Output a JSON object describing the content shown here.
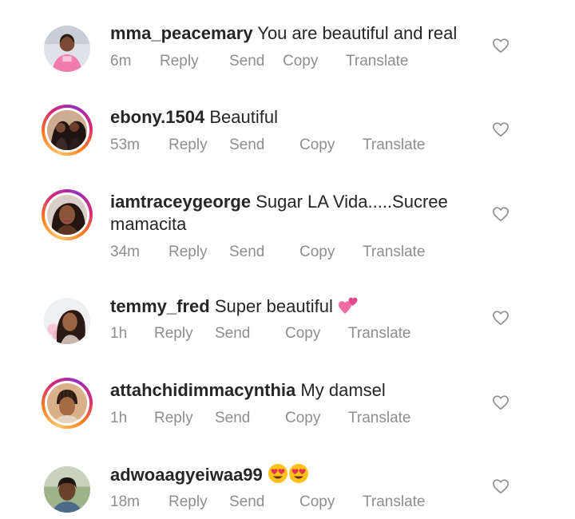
{
  "comments": [
    {
      "username": "mma_peacemary",
      "text": "You are beautiful and real",
      "time": "6m",
      "actions": [
        "Reply",
        "Send",
        "Copy",
        "Translate"
      ],
      "avatar": "woman-pink-top-avatar",
      "story_ring": false
    },
    {
      "username": "ebony.1504",
      "text": "Beautiful",
      "time": "53m",
      "actions": [
        "Reply",
        "Send",
        "Copy",
        "Translate"
      ],
      "avatar": "two-women-avatar",
      "story_ring": true
    },
    {
      "username": "iamtraceygeorge",
      "text": "Sugar LA Vida.....Sucree",
      "text_line2": "mamacita",
      "time": "34m",
      "actions": [
        "Reply",
        "Send",
        "Copy",
        "Translate"
      ],
      "avatar": "woman-portrait-avatar",
      "story_ring": true
    },
    {
      "username": "temmy_fred",
      "text": "Super beautiful",
      "emoji": "two-hearts-emoji",
      "time": "1h",
      "actions": [
        "Reply",
        "Send",
        "Copy",
        "Translate"
      ],
      "avatar": "woman-braids-avatar",
      "story_ring": false
    },
    {
      "username": "attahchidimmacynthia",
      "text": "My damsel",
      "time": "1h",
      "actions": [
        "Reply",
        "Send",
        "Copy",
        "Translate"
      ],
      "avatar": "woman-cornrows-avatar",
      "story_ring": true
    },
    {
      "username": "adwoaagyeiwaa99",
      "text": "",
      "emoji": "heart-eyes-emoji",
      "time": "18m",
      "actions": [
        "Reply",
        "Send",
        "Copy",
        "Translate"
      ],
      "avatar": "woman-outdoor-avatar",
      "story_ring": false
    }
  ],
  "colors": {
    "text": "#262626",
    "secondary": "#8e8e8e",
    "heart_outline": "#8e8e8e",
    "story_ring": [
      "#fdc468",
      "#fa7e1e",
      "#d62976",
      "#962fbf"
    ]
  },
  "icons": {
    "like": "heart-outline-icon"
  }
}
